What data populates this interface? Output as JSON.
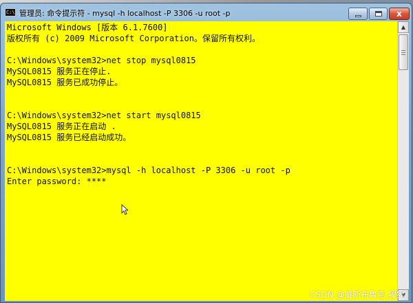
{
  "window": {
    "title": "管理员: 命令提示符 - mysql  -h localhost -P 3306 -u root -p",
    "app_icon_text": "C:\\",
    "close_label": "x"
  },
  "console": {
    "background_color": "#ffff00",
    "text_color": "#111111",
    "lines": [
      "Microsoft Windows [版本 6.1.7600]",
      "版权所有 (c) 2009 Microsoft Corporation。保留所有权利。",
      "",
      "C:\\Windows\\system32>net stop mysql0815",
      "MySQL0815 服务正在停止.",
      "MySQL0815 服务已成功停止。",
      "",
      "",
      "C:\\Windows\\system32>net start mysql0815",
      "MySQL0815 服务正在启动 .",
      "MySQL0815 服务已经启动成功。",
      "",
      "",
      "C:\\Windows\\system32>mysql -h localhost -P 3306 -u root -p",
      "Enter password: ****"
    ]
  },
  "watermark": "CSDN @威斯布鲁克.猩猩"
}
